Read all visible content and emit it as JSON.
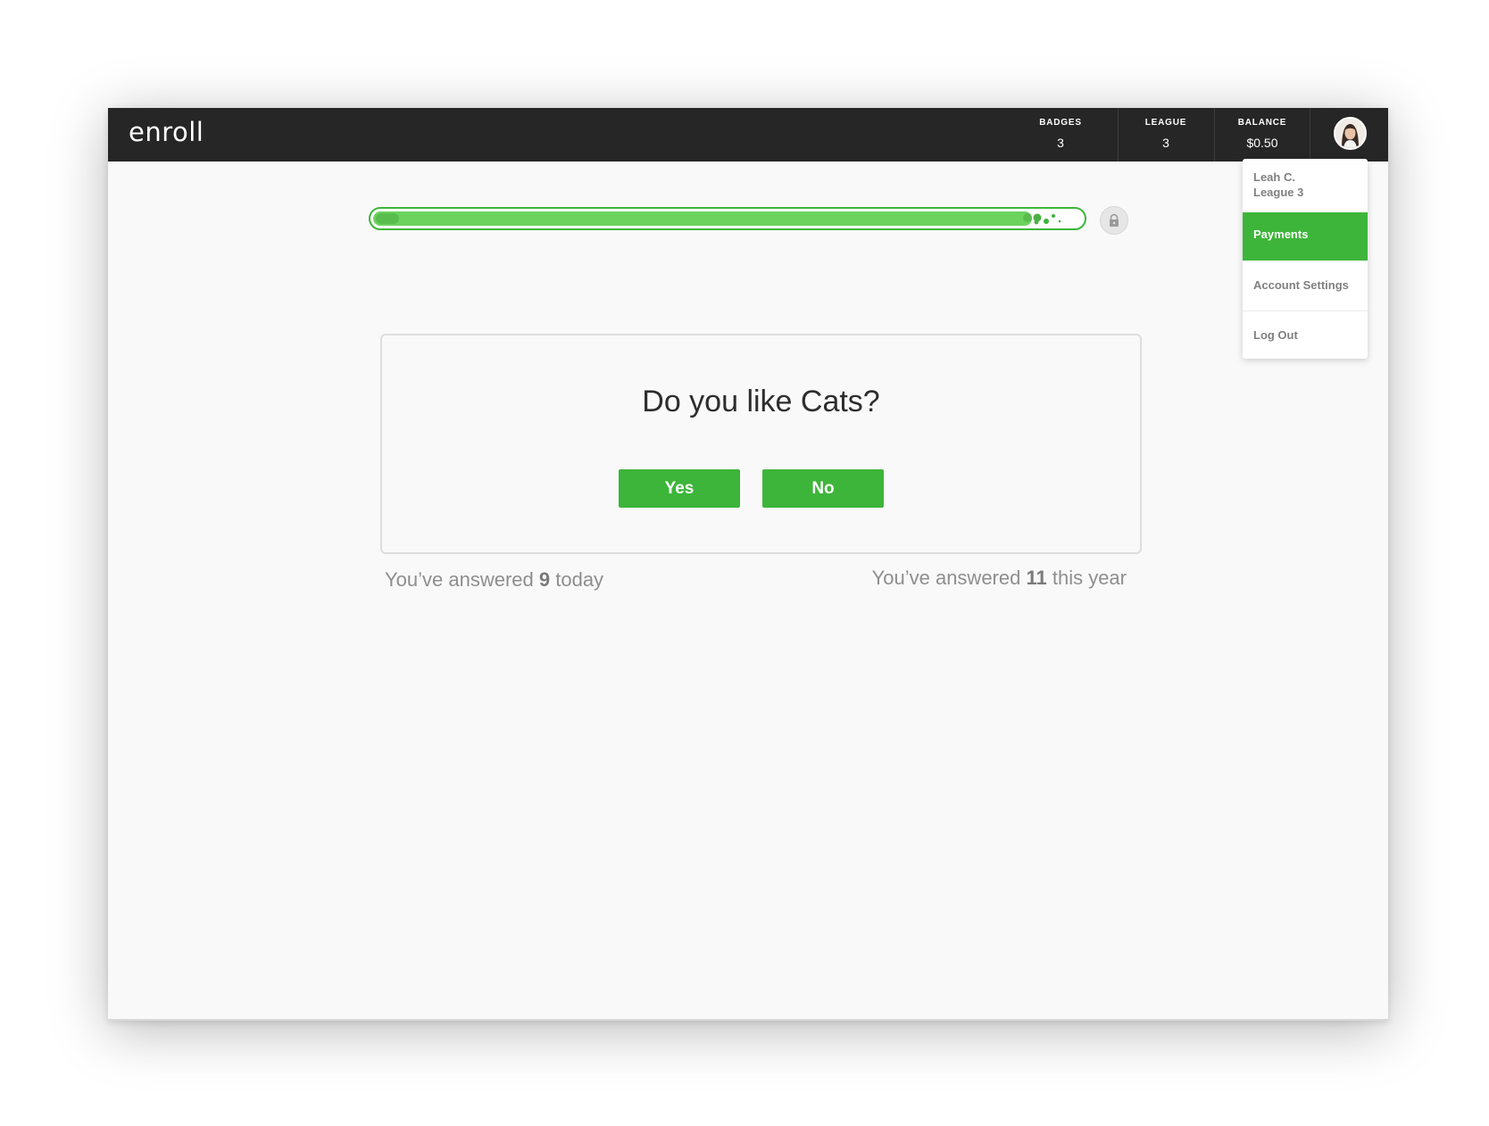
{
  "app": {
    "logo": "enroll"
  },
  "header": {
    "stats": [
      {
        "label": "BADGES",
        "value": "3"
      },
      {
        "label": "LEAGUE",
        "value": "3"
      },
      {
        "label": "BALANCE",
        "value": "$0.50"
      }
    ],
    "avatar_icon": "user-avatar"
  },
  "user_menu": {
    "name": "Leah C.",
    "league": "League 3",
    "items": [
      {
        "label": "Payments",
        "active": true
      },
      {
        "label": "Account Settings",
        "active": false
      },
      {
        "label": "Log Out",
        "active": false
      }
    ]
  },
  "progress": {
    "value": 0.93,
    "end_icon": "lock-icon",
    "accent": "#3db53a"
  },
  "question": {
    "text": "Do you like Cats?",
    "yes_label": "Yes",
    "no_label": "No"
  },
  "counts": {
    "today_prefix": "You’ve answered ",
    "today_value": "9",
    "today_suffix": " today",
    "year_prefix": "You’ve answered ",
    "year_value": "11",
    "year_suffix": " this year"
  }
}
